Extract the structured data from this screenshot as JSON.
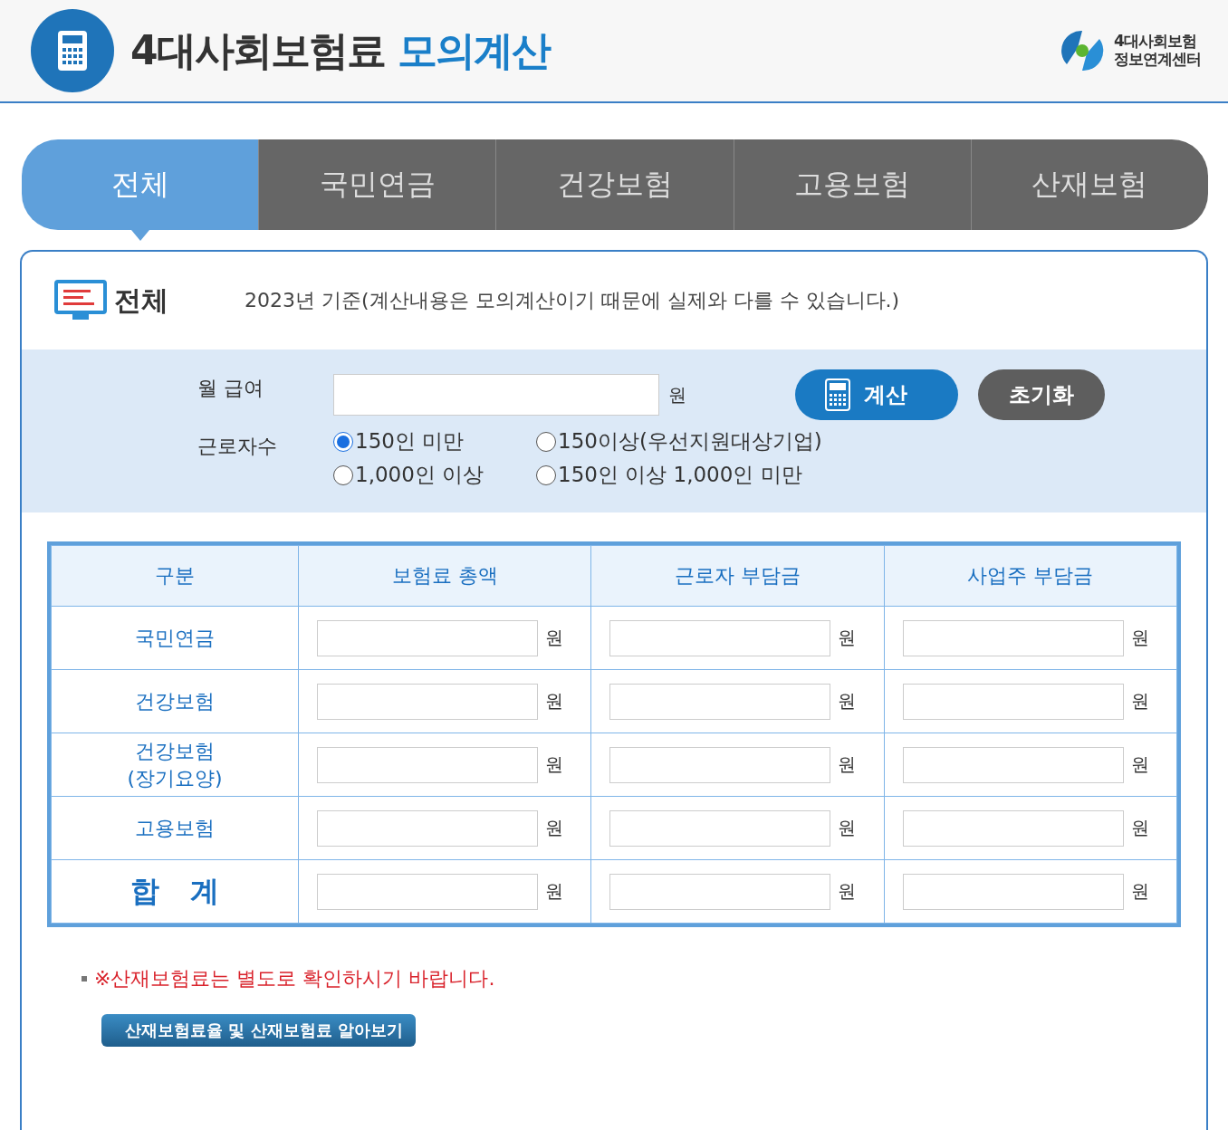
{
  "header": {
    "title": "4대사회보험료",
    "title_accent": "모의계산",
    "logo_text": [
      "4대사회보험",
      "정보연계센터"
    ]
  },
  "tabs": [
    {
      "label": "전체",
      "selected": true
    },
    {
      "label": "국민연금",
      "selected": false
    },
    {
      "label": "건강보험",
      "selected": false
    },
    {
      "label": "고용보험",
      "selected": false
    },
    {
      "label": "산재보험",
      "selected": false
    }
  ],
  "panel": {
    "heading": "전체",
    "note": "2023년 기준(계산내용은 모의계산이기 때문에 실제와 다를 수 있습니다.)"
  },
  "form": {
    "salary_label": "월 급여",
    "salary_unit": "원",
    "workers_label": "근로자수",
    "options": [
      {
        "label": "150인 미만",
        "selected": true
      },
      {
        "label": "150이상(우선지원대상기업)",
        "selected": false
      },
      {
        "label": "1,000인 이상",
        "selected": false
      },
      {
        "label": "150인 이상 1,000인 미만",
        "selected": false
      }
    ],
    "calc_button": "계산",
    "reset_button": "초기화"
  },
  "table": {
    "columns": [
      "구분",
      "보험료 총액",
      "근로자 부담금",
      "사업주 부담금"
    ],
    "rows": [
      {
        "label": "국민연금",
        "kind": "item",
        "units": [
          "원",
          "원",
          "원"
        ]
      },
      {
        "label": "건강보험",
        "kind": "item",
        "units": [
          "원",
          "원",
          "원"
        ]
      },
      {
        "label": "건강보험\n(장기요양)",
        "kind": "item",
        "units": [
          "원",
          "원",
          "원"
        ]
      },
      {
        "label": "고용보험",
        "kind": "item",
        "units": [
          "원",
          "원",
          "원"
        ]
      },
      {
        "label": "합   계",
        "kind": "total",
        "units": [
          "원",
          "원",
          "원"
        ]
      }
    ]
  },
  "notice": "※산재보험료는 별도로 확인하시기 바랍니다.",
  "link_button": "산재보험료율 및 산재보험료 알아보기"
}
